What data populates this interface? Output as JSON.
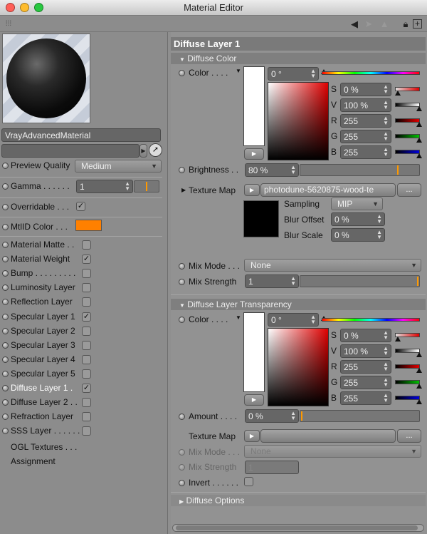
{
  "window": {
    "title": "Material Editor"
  },
  "colors": {
    "mtl_id": "#ff8000",
    "orange_marker": "#ff9900"
  },
  "left": {
    "material_name": "VrayAdvancedMaterial",
    "preview_quality": {
      "label": "Preview Quality",
      "value": "Medium"
    },
    "gamma": {
      "label": "Gamma . . . . . .",
      "value": "1"
    },
    "overridable": {
      "label": "Overridable . . .",
      "checked": true
    },
    "mtlid": {
      "label": "MtlID Color . . ."
    },
    "channels": [
      {
        "label": "Material Matte . .",
        "checked": false
      },
      {
        "label": "Material Weight",
        "checked": true
      },
      {
        "label": "Bump . . . . . . . . .",
        "checked": false
      },
      {
        "label": "Luminosity Layer",
        "checked": false
      },
      {
        "label": "Reflection Layer",
        "checked": false
      },
      {
        "label": "Specular Layer 1",
        "checked": true
      },
      {
        "label": "Specular Layer 2",
        "checked": false
      },
      {
        "label": "Specular Layer 3",
        "checked": false
      },
      {
        "label": "Specular Layer 4",
        "checked": false
      },
      {
        "label": "Specular Layer 5",
        "checked": false
      },
      {
        "label": "Diffuse Layer 1 .",
        "checked": true
      },
      {
        "label": "Diffuse Layer 2 . .",
        "checked": false
      },
      {
        "label": "Refraction Layer",
        "checked": false
      },
      {
        "label": "SSS Layer . . . . . . .",
        "checked": false
      }
    ],
    "ogl_textures": "OGL Textures . . .",
    "assignment": "Assignment"
  },
  "right": {
    "title": "Diffuse Layer 1",
    "diffuse_color": {
      "section": "Diffuse Color",
      "color_label": "Color . . . .",
      "hue": "0 °",
      "s_label": "S",
      "s": "0 %",
      "v_label": "V",
      "v": "100 %",
      "r_label": "R",
      "r": "255",
      "g_label": "G",
      "g": "255",
      "b_label": "B",
      "b": "255",
      "brightness_label": "Brightness . .",
      "brightness": "80 %",
      "texture_map_label": "Texture Map",
      "texture_file": "photodune-5620875-wood-te",
      "more": "...",
      "sampling_label": "Sampling",
      "sampling": "MIP",
      "blur_offset_label": "Blur Offset",
      "blur_offset": "0 %",
      "blur_scale_label": "Blur Scale",
      "blur_scale": "0 %",
      "mix_mode_label": "Mix Mode . . .",
      "mix_mode": "None",
      "mix_strength_label": "Mix Strength",
      "mix_strength": "1"
    },
    "transparency": {
      "section": "Diffuse Layer Transparency",
      "color_label": "Color . . . .",
      "hue": "0 °",
      "s_label": "S",
      "s": "0 %",
      "v_label": "V",
      "v": "100 %",
      "r_label": "R",
      "r": "255",
      "g_label": "G",
      "g": "255",
      "b_label": "B",
      "b": "255",
      "amount_label": "Amount . . . .",
      "amount": "0 %",
      "texture_map_label": "Texture Map",
      "more": "...",
      "mix_mode_label": "Mix Mode . . .",
      "mix_mode": "None",
      "mix_strength_label": "Mix Strength",
      "mix_strength": "1",
      "invert_label": "Invert . . . . . ."
    },
    "diffuse_options": "Diffuse Options"
  }
}
